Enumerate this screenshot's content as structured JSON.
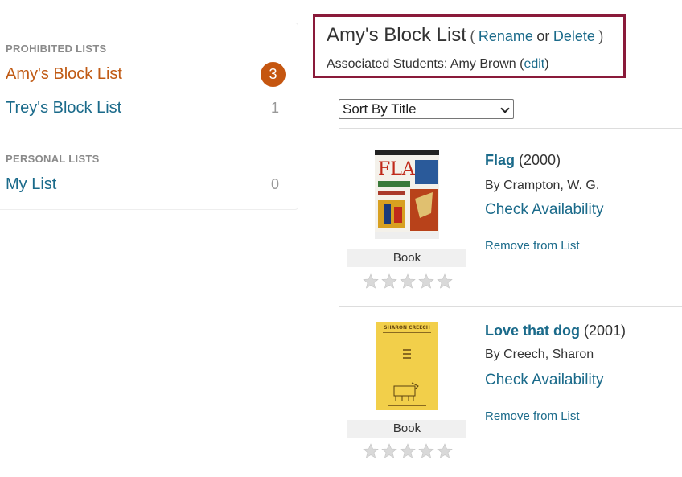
{
  "sidebar": {
    "prohibited_heading": "PROHIBITED LISTS",
    "prohibited": [
      {
        "label": "Amy's Block List",
        "count": "3",
        "active": true
      },
      {
        "label": "Trey's Block List",
        "count": "1",
        "active": false
      }
    ],
    "personal_heading": "PERSONAL LISTS",
    "personal": [
      {
        "label": "My List",
        "count": "0",
        "active": false
      }
    ]
  },
  "header": {
    "title": "Amy's Block List",
    "open_paren": "(",
    "rename_label": "Rename",
    "or_text": "or",
    "delete_label": "Delete",
    "close_paren": ")",
    "assoc_prefix": "Associated Students: Amy Brown (",
    "edit_label": "edit",
    "assoc_suffix": ")"
  },
  "sort": {
    "selected": "Sort By Title"
  },
  "records": [
    {
      "title": "Flag",
      "year": "(2000)",
      "author": "By Crampton, W. G.",
      "availability": "Check Availability",
      "remove": "Remove from List",
      "format": "Book",
      "cover_text": "FLAG",
      "rating": 0
    },
    {
      "title": "Love that dog",
      "year": "(2001)",
      "author": "By Creech, Sharon",
      "availability": "Check Availability",
      "remove": "Remove from List",
      "format": "Book",
      "cover_text": "SHARON CREECH",
      "rating": 0
    }
  ],
  "colors": {
    "link": "#1a6a8a",
    "active": "#c05a14",
    "badge": "#c55610",
    "highlight_border": "#8a1a3a",
    "star": "#d9d9d9"
  }
}
